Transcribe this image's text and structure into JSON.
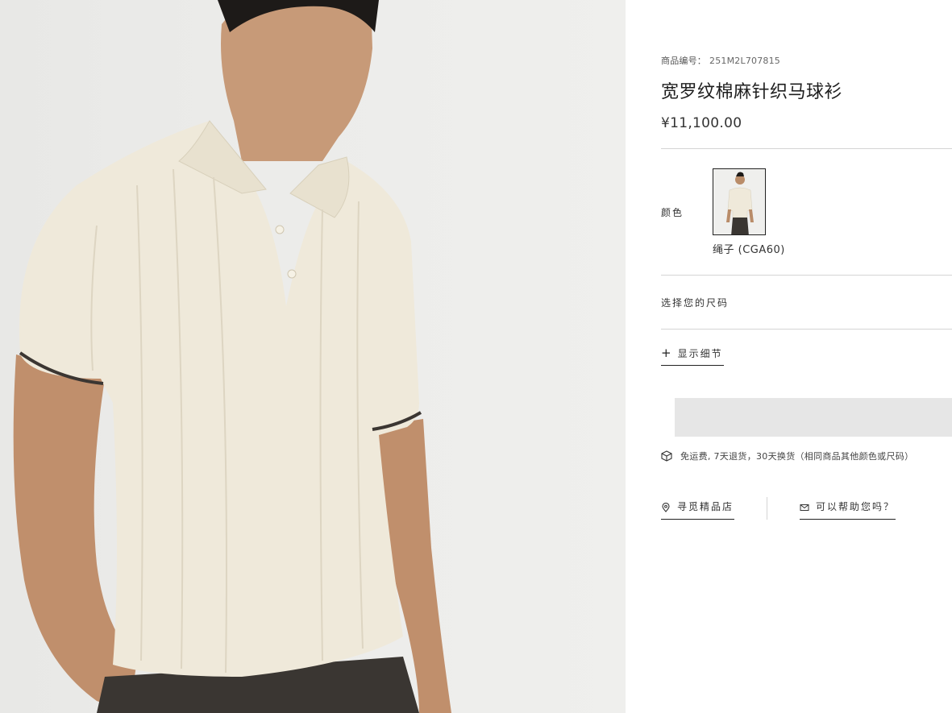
{
  "product": {
    "sku_label": "商品编号：",
    "sku_code": "251M2L707815",
    "title": "宽罗纹棉麻针织马球衫",
    "price": "¥11,100.00"
  },
  "color": {
    "label": "颜色",
    "selected_name": "绳子 (CGA60)"
  },
  "size": {
    "label": "选择您的尺码"
  },
  "details": {
    "plus": "+",
    "label": "显示细节"
  },
  "shipping": {
    "icon": "box-icon",
    "text": "免运费, 7天退货，30天换货（相同商品其他颜色或尺码）"
  },
  "links": {
    "store": {
      "icon": "location-pin-icon",
      "label": "寻觅精品店"
    },
    "help": {
      "icon": "mail-icon",
      "label": "可以帮助您吗？"
    }
  },
  "colors": {
    "background": "#ffffff",
    "cta_placeholder": "#e6e6e6",
    "shirt": "#efe9da",
    "text": "#222222"
  }
}
